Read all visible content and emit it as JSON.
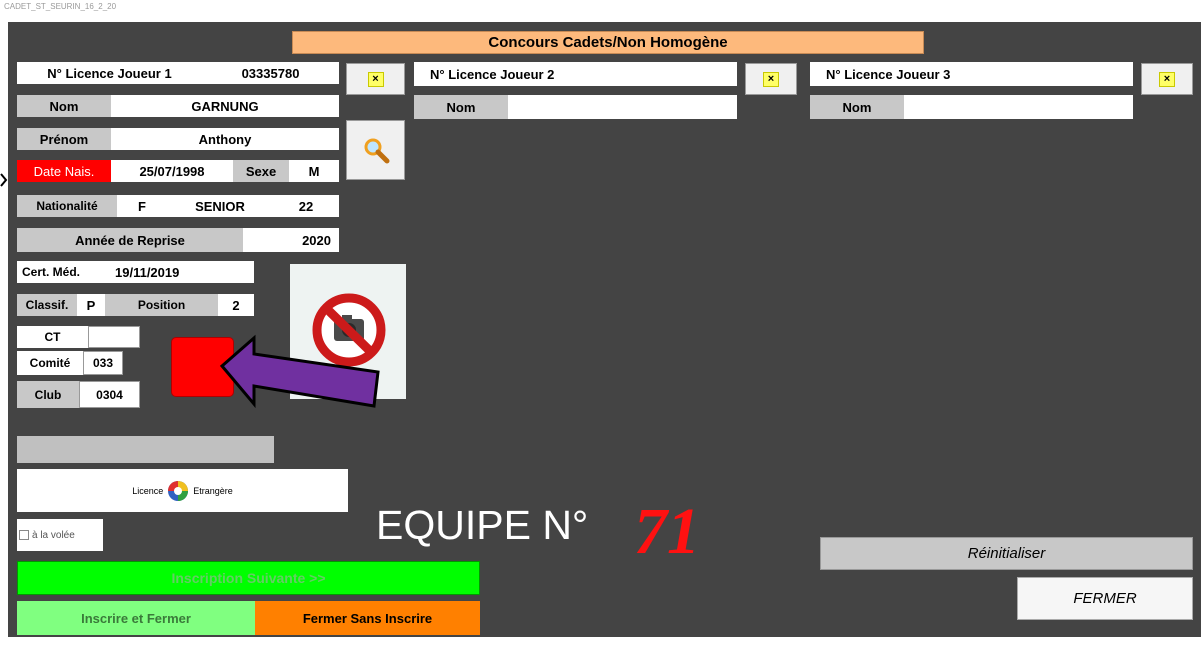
{
  "window": {
    "title": "CADET_ST_SEURIN_16_2_20"
  },
  "header": {
    "title": "Concours Cadets/Non Homogène"
  },
  "player1": {
    "licence_label": "N° Licence Joueur 1",
    "licence_value": "03335780",
    "nom_label": "Nom",
    "nom_value": "GARNUNG",
    "prenom_label": "Prénom",
    "prenom_value": "Anthony",
    "datenais_label": "Date Nais.",
    "datenais_value": "25/07/1998",
    "sexe_label": "Sexe",
    "sexe_value": "M",
    "nationalite_label": "Nationalité",
    "nationalite_value": "F",
    "categorie_value": "SENIOR",
    "age_value": "22",
    "reprise_label": "Année de Reprise",
    "reprise_value": "2020",
    "certmed_label": "Cert. Méd.",
    "certmed_value": "19/11/2019",
    "classif_label": "Classif.",
    "classif_value": "P",
    "position_label": "Position",
    "position_value": "2",
    "ct_label": "CT",
    "ct_value": "",
    "comite_label": "Comité",
    "comite_value": "033",
    "club_label": "Club",
    "club_value": "0304"
  },
  "player2": {
    "licence_label": "N° Licence Joueur 2",
    "licence_value": "",
    "nom_label": "Nom",
    "nom_value": ""
  },
  "player3": {
    "licence_label": "N° Licence Joueur 3",
    "licence_value": "",
    "nom_label": "Nom",
    "nom_value": ""
  },
  "clear_button": {
    "label": "×"
  },
  "licence_etrangere": {
    "left": "Licence",
    "right": "Etrangère"
  },
  "volee": {
    "label": "à la volée",
    "checked": false
  },
  "team": {
    "label": "EQUIPE N°",
    "number": "71"
  },
  "buttons": {
    "inscription_suivante": "Inscription Suivante >>",
    "inscrire_fermer": "Inscrire et Fermer",
    "fermer_sans": "Fermer Sans Inscrire",
    "reinitialiser": "Réinitialiser",
    "fermer": "FERMER"
  },
  "colors": {
    "panel": "#444444",
    "title_bg": "#fdb97c",
    "date_label_bg": "#ff0000",
    "inscription_suivante_bg": "#00ff00",
    "inscrire_fermer_bg": "#80ff80",
    "fermer_sans_bg": "#ff8000",
    "status_square": "#ff0000",
    "arrow": "#7030a0",
    "team_number": "#ff1111"
  }
}
